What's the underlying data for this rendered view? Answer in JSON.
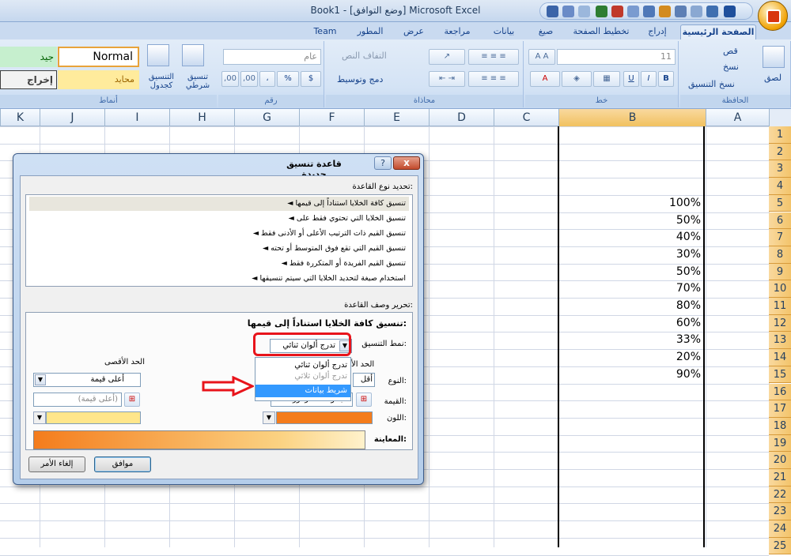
{
  "window": {
    "title": "Book1  -  [وضع التوافق]  Microsoft Excel"
  },
  "tabs": [
    "الصفحة الرئيسية",
    "إدراج",
    "تخطيط الصفحة",
    "صيغ",
    "بيانات",
    "مراجعة",
    "عرض",
    "المطور",
    "Team"
  ],
  "ribbon": {
    "clipboard": {
      "label": "الحافظة",
      "paste": "لصق",
      "cut": "قص",
      "copy": "نسخ",
      "format_painter": "نسخ التنسيق"
    },
    "font": {
      "label": "خط",
      "size": "11",
      "bold": "B",
      "italic": "I",
      "underline": "U"
    },
    "alignment": {
      "label": "محاذاة",
      "wrap": "التفاف النص",
      "merge": "دمج وتوسيط"
    },
    "number": {
      "label": "رقم",
      "format": "عام",
      "percent": "%",
      "comma": "،",
      "inc": ",00",
      "dec": ",00"
    },
    "styles": {
      "label": "أنماط",
      "conditional": "تنسيق شرطي",
      "table": "التنسيق كجدول",
      "normal": "Normal",
      "good": "جيد",
      "neutral": "محايد",
      "output": "إخراج"
    }
  },
  "columns": [
    "A",
    "B",
    "C",
    "D",
    "E",
    "F",
    "G",
    "H",
    "I",
    "J",
    "K"
  ],
  "rows": [
    "1",
    "2",
    "3",
    "4",
    "5",
    "6",
    "7",
    "8",
    "9",
    "10",
    "11",
    "12",
    "13",
    "14",
    "15",
    "16",
    "17",
    "18",
    "19",
    "20",
    "21",
    "22",
    "23",
    "24",
    "25"
  ],
  "cells_b": [
    "100%",
    "50%",
    "40%",
    "30%",
    "50%",
    "70%",
    "80%",
    "60%",
    "33%",
    "20%",
    "90%"
  ],
  "dialog": {
    "title": "قاعدة تنسيق جديدة",
    "help": "?",
    "close": "x",
    "select_type_label": "تحديد نوع القاعدة:",
    "rule_types": [
      "◄  تنسيق كافة الخلايا استناداً إلى قيمها",
      "◄  تنسيق الخلايا التي تحتوي فقط على",
      "◄  تنسيق القيم ذات الترتيب الأعلى أو الأدنى فقط",
      "◄  تنسيق القيم التي تقع فوق المتوسط أو تحته",
      "◄  تنسيق القيم الفريدة أو المتكررة فقط",
      "◄  استخدام صيغة لتحديد الخلايا التي سيتم تنسيقها"
    ],
    "edit_desc_label": "تحرير وصف القاعدة:",
    "desc_heading": "تنسيق كافة الخلايا استناداً إلى قيمها:",
    "format_style_label": "نمط التنسيق:",
    "format_style_value": "تدرج ألوان ثنائي",
    "max_label": "الحد الأقصى",
    "min_label_partial": "الحد الأ",
    "type_label": "النوع:",
    "type_min_value": "أقل",
    "type_max_value": "أعلى قيمة",
    "value_label": "القيمة:",
    "value_min_value": "مجموعات الرموز",
    "value_max_placeholder": "(أعلى قيمة)",
    "color_label": "اللون:",
    "preview_label": "المعاينة:",
    "ok": "موافق",
    "cancel": "إلغاء الأمر",
    "dropdown_options": [
      "تدرج ألوان ثنائي",
      "تدرج ألوان ثلاثي",
      "شريط بيانات"
    ],
    "selected_option": "شريط بيانات"
  }
}
